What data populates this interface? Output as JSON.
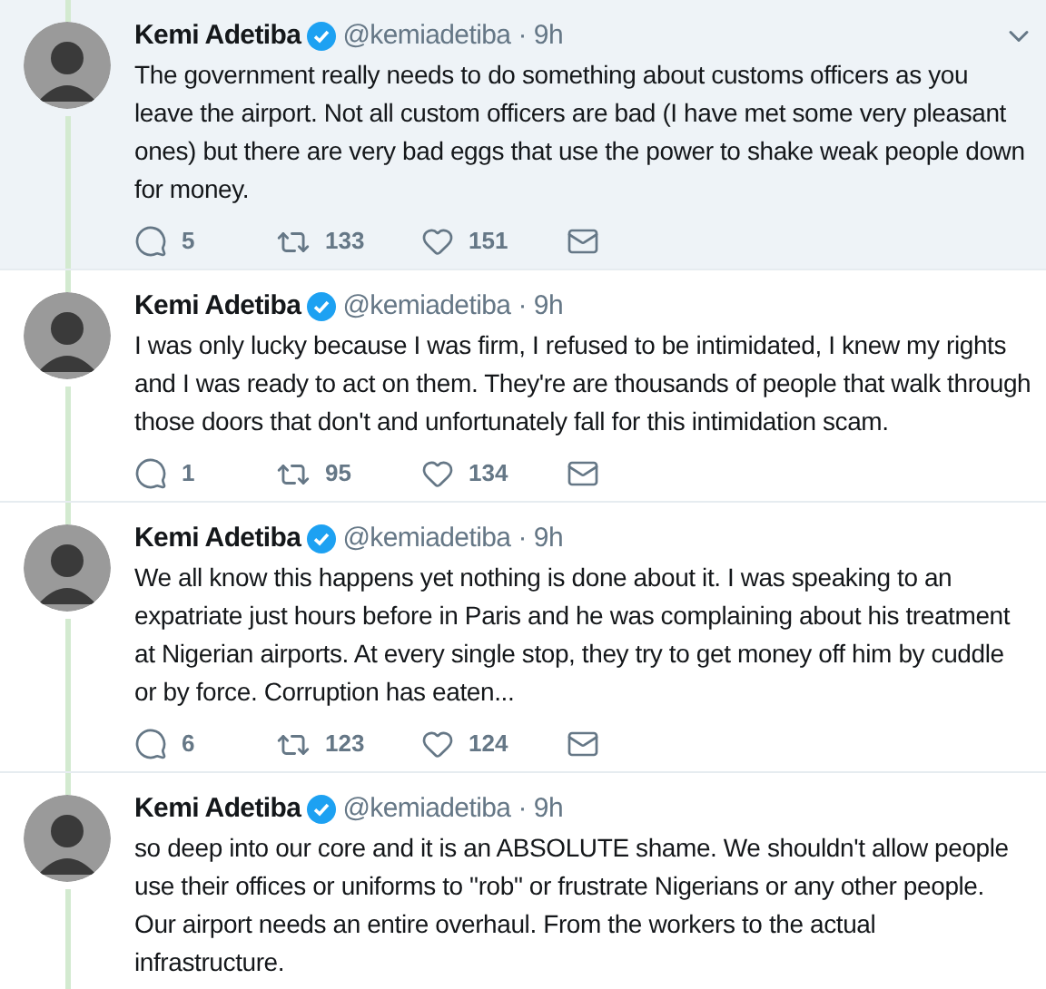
{
  "tweets": [
    {
      "name": "Kemi Adetiba",
      "handle": "@kemiadetiba",
      "separator": "·",
      "time": "9h",
      "highlighted": true,
      "menu_visible": true,
      "text": "The government really needs to do something about customs officers as you leave the airport. Not all custom officers are bad (I have met some very pleasant ones) but there are very bad eggs that use the power to shake weak people down for money.",
      "actions": {
        "replies": "5",
        "retweets": "133",
        "likes": "151"
      }
    },
    {
      "name": "Kemi Adetiba",
      "handle": "@kemiadetiba",
      "separator": "·",
      "time": "9h",
      "highlighted": false,
      "menu_visible": false,
      "text": "I was only lucky because I was firm, I refused to be intimidated, I knew my rights and I was ready to act on them. They're are thousands of people that walk through those doors that don't and unfortunately fall for this intimidation scam.",
      "actions": {
        "replies": "1",
        "retweets": "95",
        "likes": "134"
      }
    },
    {
      "name": "Kemi Adetiba",
      "handle": "@kemiadetiba",
      "separator": "·",
      "time": "9h",
      "highlighted": false,
      "menu_visible": false,
      "text": "We all know this happens yet nothing is done about it. I was speaking to an expatriate just hours before in Paris and he was complaining about his treatment at Nigerian airports. At every single stop, they try to get money off him by cuddle or by force. Corruption has eaten...",
      "actions": {
        "replies": "6",
        "retweets": "123",
        "likes": "124"
      }
    },
    {
      "name": "Kemi Adetiba",
      "handle": "@kemiadetiba",
      "separator": "·",
      "time": "9h",
      "highlighted": false,
      "menu_visible": false,
      "text": "so deep into our core and it is an ABSOLUTE shame. We shouldn't allow people use their offices or uniforms to \"rob\" or frustrate Nigerians or any other people. Our airport needs an entire overhaul. From the workers to the actual infrastructure."
    }
  ]
}
